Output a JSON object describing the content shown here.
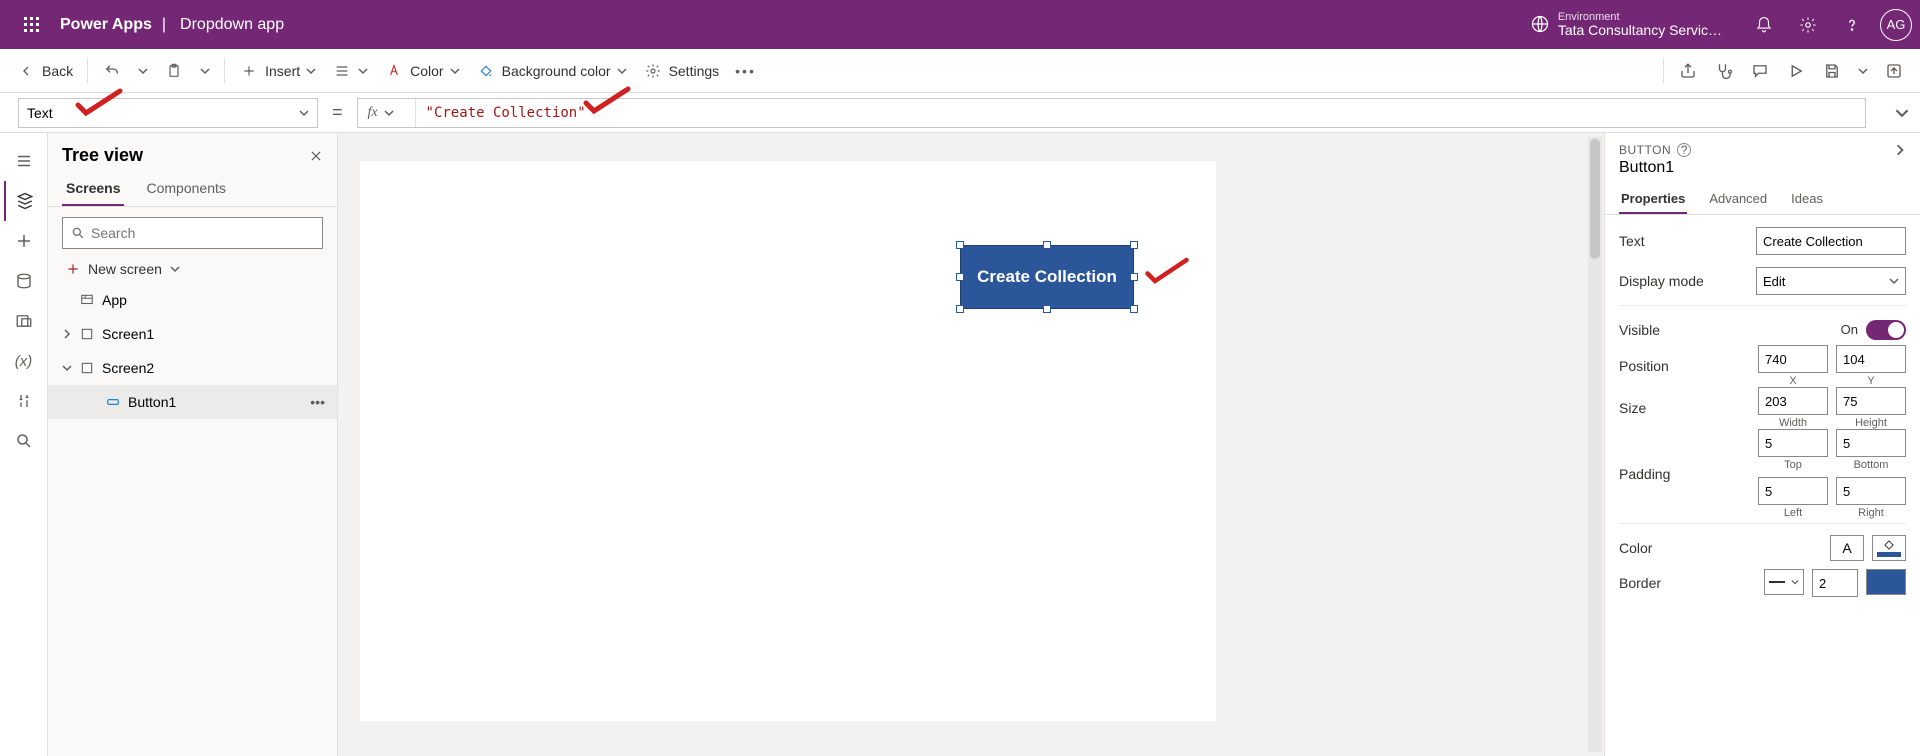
{
  "header": {
    "product": "Power Apps",
    "separator": "|",
    "app_name": "Dropdown app",
    "env_label": "Environment",
    "env_name": "Tata Consultancy Servic…",
    "avatar_initials": "AG"
  },
  "cmdbar": {
    "back": "Back",
    "insert": "Insert",
    "color": "Color",
    "bgcolor": "Background color",
    "settings": "Settings"
  },
  "formula": {
    "property": "Text",
    "fx": "fx",
    "value": "\"Create Collection\""
  },
  "tree": {
    "title": "Tree view",
    "tabs": {
      "screens": "Screens",
      "components": "Components"
    },
    "search_placeholder": "Search",
    "new_screen": "New screen",
    "items": {
      "app": "App",
      "screen1": "Screen1",
      "screen2": "Screen2",
      "button1": "Button1"
    }
  },
  "canvas": {
    "button_text": "Create Collection"
  },
  "props": {
    "type": "BUTTON",
    "name": "Button1",
    "tabs": {
      "properties": "Properties",
      "advanced": "Advanced",
      "ideas": "Ideas"
    },
    "text_label": "Text",
    "text_value": "Create Collection",
    "display_label": "Display mode",
    "display_value": "Edit",
    "visible_label": "Visible",
    "visible_on": "On",
    "position_label": "Position",
    "pos_x": "740",
    "pos_y": "104",
    "sub_x": "X",
    "sub_y": "Y",
    "size_label": "Size",
    "size_w": "203",
    "size_h": "75",
    "sub_w": "Width",
    "sub_h": "Height",
    "padding_label": "Padding",
    "pad_t": "5",
    "pad_b": "5",
    "pad_l": "5",
    "pad_r": "5",
    "sub_t": "Top",
    "sub_bt": "Bottom",
    "sub_l": "Left",
    "sub_r": "Right",
    "color_label": "Color",
    "border_label": "Border",
    "border_width": "2"
  }
}
